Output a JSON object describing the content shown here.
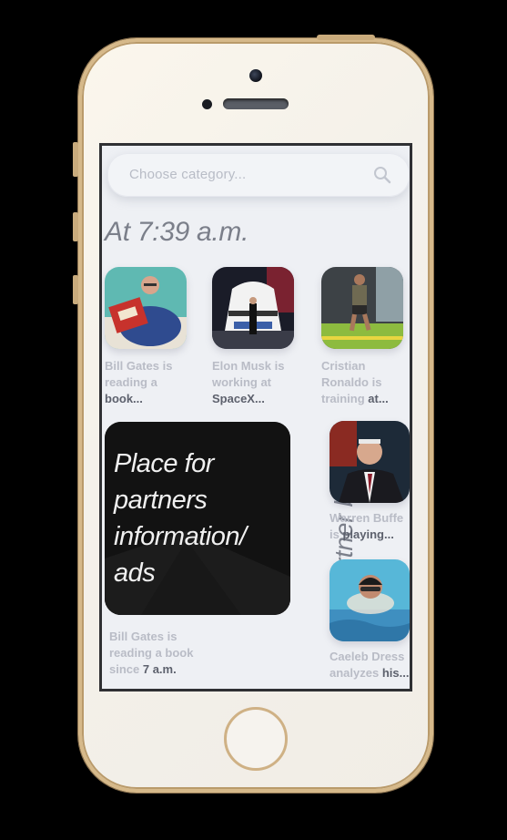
{
  "search": {
    "placeholder": "Choose category..."
  },
  "section_title": "At 7:39 a.m.",
  "stories": [
    {
      "line1": "Bill Gates is",
      "line2": "reading a",
      "line3": "book..."
    },
    {
      "line1": "Elon Musk is",
      "line2": "working at",
      "line3": "SpaceX..."
    },
    {
      "line1": "Cristian",
      "line2": "Ronaldo is",
      "line3a": "training ",
      "line3b": "at..."
    }
  ],
  "ad": {
    "text_lines": [
      "Place for",
      "partners",
      "information/",
      "ads"
    ],
    "caption_line1": "Bill Gates is",
    "caption_line2": "reading a book",
    "caption_line3a": "since ",
    "caption_line3b": "7 a.m."
  },
  "partner_label": "Partner block",
  "side_stories": [
    {
      "line1": "Warren Buffe",
      "line2a": "is ",
      "line2b": "playing..."
    },
    {
      "line1": "Caeleb Dress",
      "line2a": "analyzes ",
      "line2b": "his..."
    }
  ]
}
